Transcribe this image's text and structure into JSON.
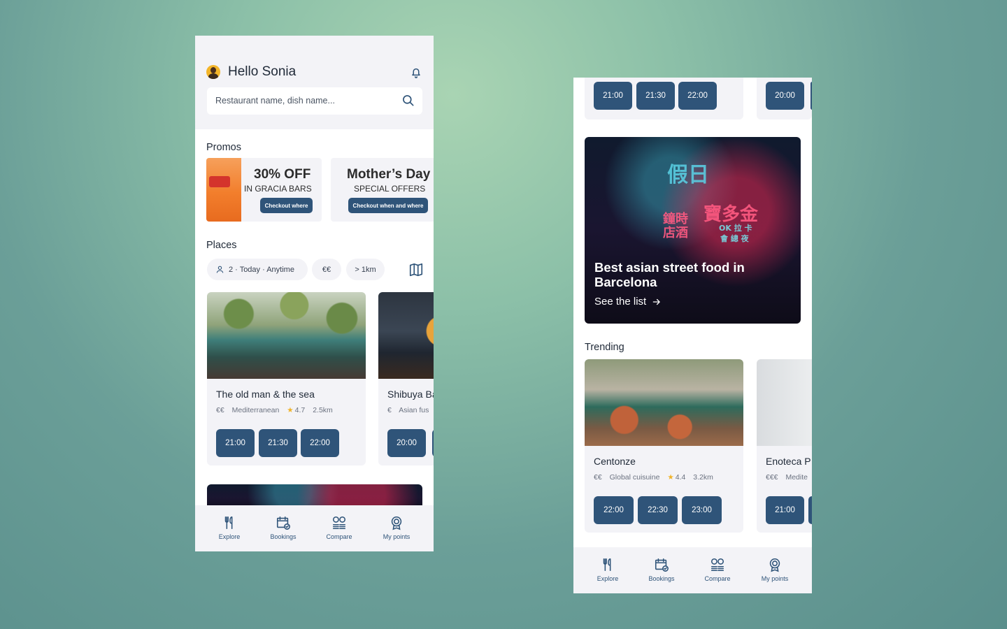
{
  "screen1": {
    "greeting": "Hello Sonia",
    "search": {
      "placeholder": "Restaurant name, dish name..."
    },
    "promos_title": "Promos",
    "promos": [
      {
        "title": "30% OFF",
        "subtitle": "IN GRACIA BARS",
        "button": "Checkout where"
      },
      {
        "title": "Mother’s Day",
        "subtitle": "SPECIAL OFFERS",
        "button": "Checkout when and where"
      }
    ],
    "places_title": "Places",
    "filters": {
      "party": "2 · Today · Anytime",
      "price": "€€",
      "distance": "> 1km"
    },
    "restaurants": [
      {
        "name": "The old man & the sea",
        "price": "€€",
        "cuisine": "Mediterranean",
        "rating": "4.7",
        "distance": "2.5km",
        "slots": [
          "21:00",
          "21:30",
          "22:00"
        ]
      },
      {
        "name": "Shibuya Ba",
        "price": "€",
        "cuisine": "Asian fus",
        "slots": [
          "20:00"
        ]
      }
    ]
  },
  "screen2": {
    "top_slots": [
      "21:00",
      "21:30",
      "22:00",
      "20:00"
    ],
    "feature": {
      "title": "Best asian street food in Barcelona",
      "link": "See the list"
    },
    "trending_title": "Trending",
    "trending": [
      {
        "name": "Centonze",
        "price": "€€",
        "cuisine": "Global cuisuine",
        "rating": "4.4",
        "distance": "3.2km",
        "slots": [
          "22:00",
          "22:30",
          "23:00"
        ]
      },
      {
        "name": "Enoteca P",
        "price": "€€€",
        "cuisine": "Medite",
        "slots": [
          "21:00"
        ]
      }
    ]
  },
  "nav": {
    "explore": "Explore",
    "bookings": "Bookings",
    "compare": "Compare",
    "points": "My points"
  },
  "neon_signs": {
    "a": "假日",
    "b": "鐘時",
    "c": "店酒",
    "d": "寶多金",
    "e": "OK 拉 卡",
    "f": "會 總 夜"
  },
  "colors": {
    "primary": "#2f5479",
    "star": "#f0b429",
    "panel": "#f3f3f7"
  }
}
